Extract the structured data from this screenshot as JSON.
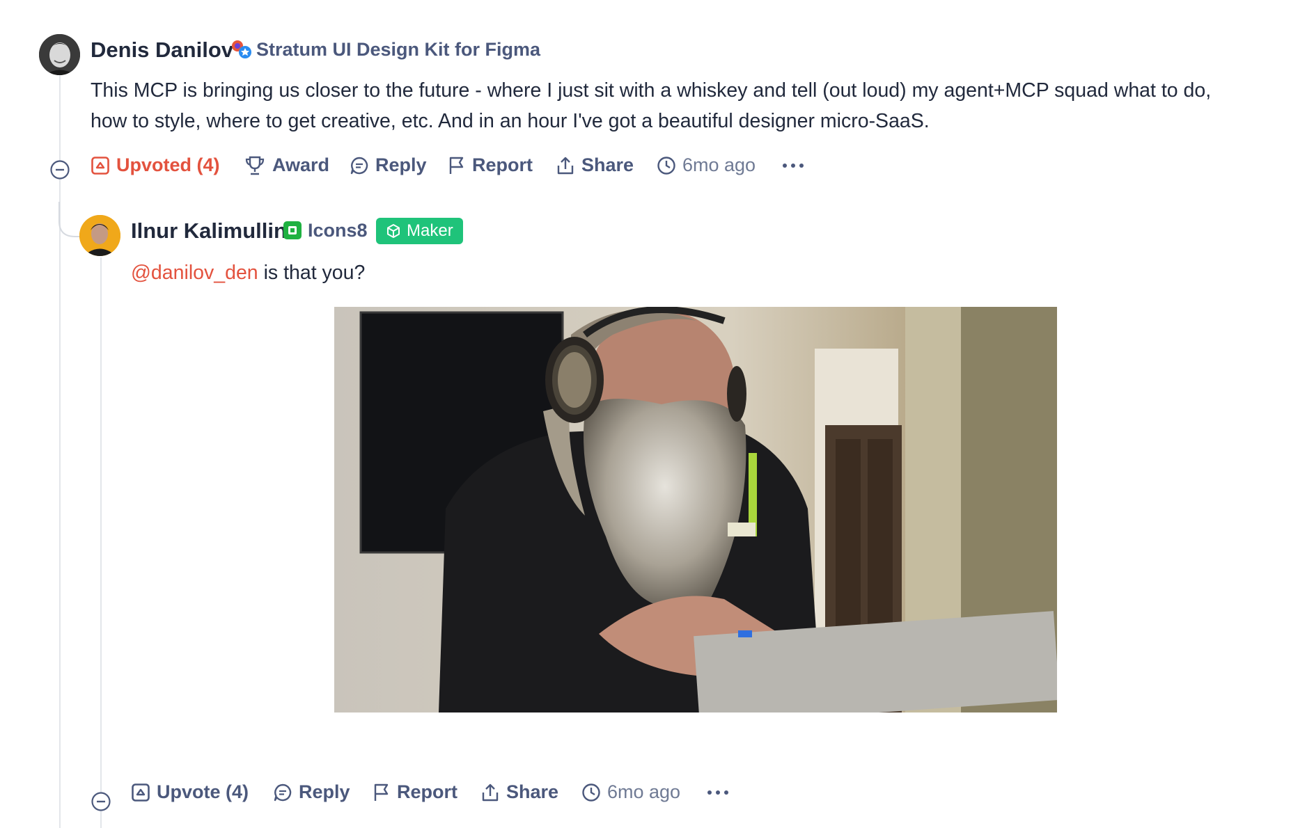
{
  "comments": {
    "parent": {
      "author": "Denis Danilov",
      "product": "Stratum UI Design Kit for Figma",
      "text": "This MCP is bringing us closer to the future - where I just sit with a whiskey and tell (out loud) my agent+MCP squad what to do, how to style, where to get creative, etc. And in an hour I've got a beautiful designer micro-SaaS.",
      "actions": {
        "upvote": "Upvoted (4)",
        "award": "Award",
        "reply": "Reply",
        "report": "Report",
        "share": "Share",
        "time": "6mo ago"
      }
    },
    "reply": {
      "author": "Ilnur Kalimullin",
      "product": "Icons8",
      "badge": "Maker",
      "mention": "@danilov_den",
      "text": " is that you?",
      "actions": {
        "upvote": "Upvote (4)",
        "reply": "Reply",
        "report": "Report",
        "share": "Share",
        "time": "6mo ago"
      }
    }
  },
  "colors": {
    "accent": "#e3523e",
    "maker_badge": "#1fc37a",
    "muted_text": "#4b587c"
  },
  "icons": [
    "upvote-icon",
    "trophy-icon",
    "reply-bubble-icon",
    "flag-icon",
    "share-icon",
    "clock-icon",
    "more-icon",
    "collapse-icon"
  ]
}
